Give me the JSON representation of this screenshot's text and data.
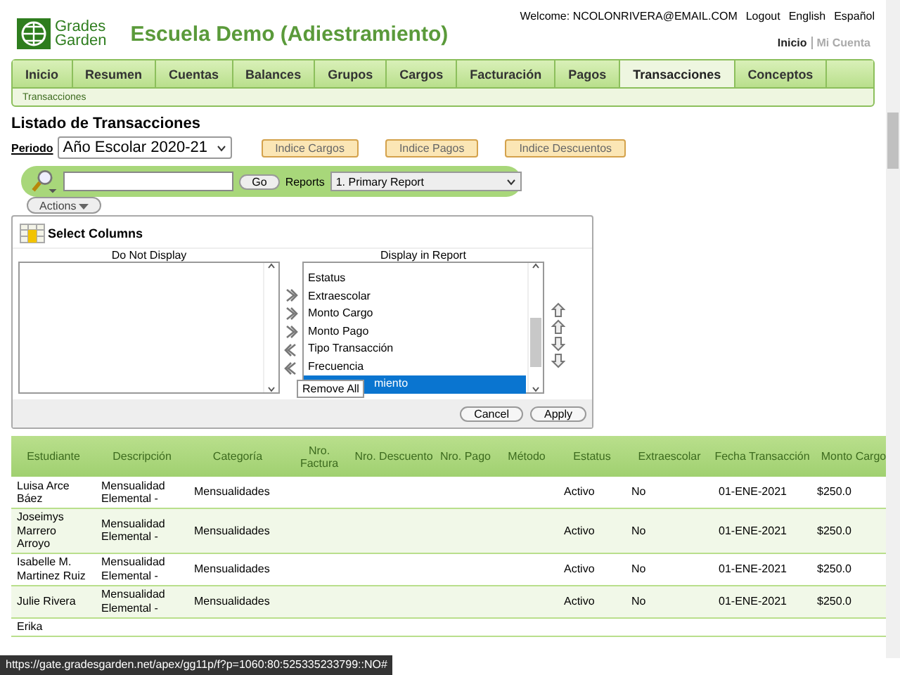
{
  "header": {
    "logo_line1": "Grades",
    "logo_line2": "Garden",
    "school": "Escuela Demo (Adiestramiento)",
    "welcome": "Welcome: NCOLONRIVERA@EMAIL.COM",
    "links": [
      "Logout",
      "English",
      "Español"
    ],
    "account_links": [
      {
        "label": "Inicio",
        "selected": true
      },
      {
        "label": "Mi Cuenta",
        "selected": false
      }
    ]
  },
  "tabs": [
    {
      "label": "Inicio",
      "selected": false
    },
    {
      "label": "Resumen",
      "selected": false
    },
    {
      "label": "Cuentas",
      "selected": false
    },
    {
      "label": "Balances",
      "selected": false
    },
    {
      "label": "Grupos",
      "selected": false
    },
    {
      "label": "Cargos",
      "selected": false
    },
    {
      "label": "Facturación",
      "selected": false
    },
    {
      "label": "Pagos",
      "selected": false
    },
    {
      "label": "Transacciones",
      "selected": true
    },
    {
      "label": "Conceptos",
      "selected": false
    }
  ],
  "subtab": "Transacciones",
  "title": "Listado de Transacciones",
  "periodo": {
    "label": "Periodo",
    "value": "Año Escolar 2020-21"
  },
  "index_buttons": [
    "Indice Cargos",
    "Indice Pagos",
    "Indice Descuentos"
  ],
  "search": {
    "go": "Go",
    "reports_label": "Reports",
    "report": "1. Primary Report",
    "actions": "Actions"
  },
  "select_columns": {
    "title": "Select Columns",
    "left_heading": "Do Not Display",
    "right_heading": "Display in Report",
    "right_items": [
      {
        "label": "Estatus",
        "selected": false
      },
      {
        "label": "Extraescolar",
        "selected": false
      },
      {
        "label": "Monto Cargo",
        "selected": false
      },
      {
        "label": "Monto Pago",
        "selected": false
      },
      {
        "label": "Tipo Transacción",
        "selected": false
      },
      {
        "label": "Frecuencia",
        "selected": false
      },
      {
        "label": "miento",
        "selected": true
      }
    ],
    "tooltip": "Remove All",
    "cancel": "Cancel",
    "apply": "Apply"
  },
  "table": {
    "columns": [
      "Estudiante",
      "Descripción",
      "Categoría",
      "Nro. Factura",
      "Nro. Descuento",
      "Nro. Pago",
      "Método",
      "Estatus",
      "Extraescolar",
      "Fecha Transacción",
      "Monto Cargo"
    ],
    "rows": [
      [
        "Luisa Arce Báez",
        "Mensualidad Elemental -",
        "Mensualidades",
        "",
        "",
        "",
        "",
        "Activo",
        "No",
        "01-ENE-2021",
        "$250.0"
      ],
      [
        "Joseimys Marrero Arroyo",
        "Mensualidad Elemental -",
        "Mensualidades",
        "",
        "",
        "",
        "",
        "Activo",
        "No",
        "01-ENE-2021",
        "$250.0"
      ],
      [
        "Isabelle M. Martinez Ruiz",
        "Mensualidad Elemental -",
        "Mensualidades",
        "",
        "",
        "",
        "",
        "Activo",
        "No",
        "01-ENE-2021",
        "$250.0"
      ],
      [
        "Julie Rivera",
        "Mensualidad Elemental -",
        "Mensualidades",
        "",
        "",
        "",
        "",
        "Activo",
        "No",
        "01-ENE-2021",
        "$250.0"
      ],
      [
        "Erika",
        "",
        "",
        "",
        "",
        "",
        "",
        "",
        "",
        "",
        ""
      ]
    ]
  },
  "status_url": "https://gate.gradesgarden.net/apex/gg11p/f?p=1060:80:525335233799::NO#"
}
